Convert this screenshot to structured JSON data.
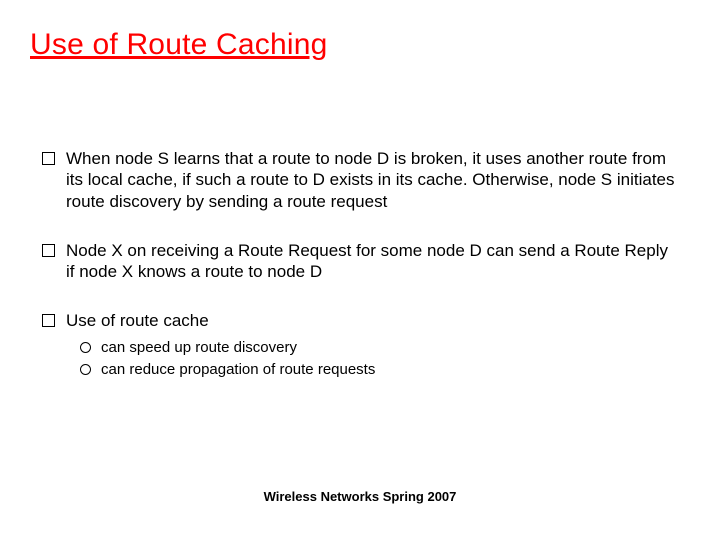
{
  "slide": {
    "title": "Use of Route Caching",
    "bullets": [
      {
        "text": "When node S learns that a route to node D is broken, it uses another route from its local cache, if such a route to D exists in its cache. Otherwise, node S initiates route discovery by sending a route request"
      },
      {
        "text": "Node X on receiving a Route Request for some node D can send a Route Reply if node X knows a route to node D"
      },
      {
        "text": "Use of route cache",
        "sub": [
          "can speed up route discovery",
          "can reduce propagation of route requests"
        ]
      }
    ],
    "footer": "Wireless Networks Spring 2007"
  }
}
